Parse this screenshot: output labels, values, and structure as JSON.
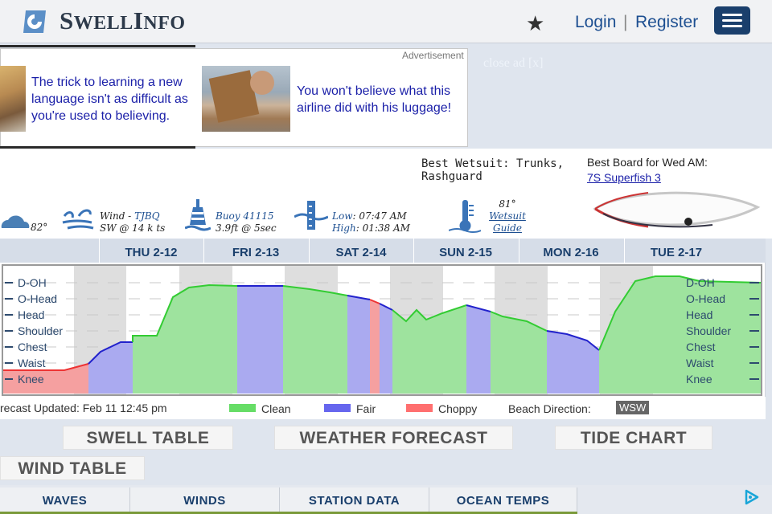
{
  "header": {
    "logo_text_first": "S",
    "logo_text_rest": "WELL",
    "logo_text_first2": "I",
    "logo_text_rest2": "NFO",
    "login": "Login",
    "separator": "|",
    "register": "Register",
    "icons": [
      "logo-icon",
      "star-icon",
      "menu-icon"
    ]
  },
  "ad": {
    "label": "Advertisement",
    "text1": "The trick to learning a new language isn't as difficult as you're used to believing.",
    "text2": "You won't believe what this airline did with his luggage!",
    "close": "close ad [x]"
  },
  "info": {
    "best_wetsuit": "Best Wetsuit: Trunks, Rashguard",
    "best_board_label": "Best Board for Wed AM:",
    "best_board": "7S Superfish 3",
    "air_temp": "82°",
    "wind_label": "Wind - ",
    "wind_station": "TJBQ",
    "wind_value": "SW @ 14 k ts",
    "buoy": "Buoy 41115",
    "buoy_value": "3.9ft @ 5sec",
    "tide_low_label": "Low",
    "tide_low": ": 07:47 AM",
    "tide_high_label": "High",
    "tide_high": ": 01:38 AM",
    "water_temp": "81°",
    "wetsuit_guide_1": "Wetsuit",
    "wetsuit_guide_2": "Guide"
  },
  "forecast": {
    "days": [
      "THU 2-12",
      "FRI 2-13",
      "SAT 2-14",
      "SUN 2-15",
      "MON 2-16",
      "TUE 2-17"
    ],
    "size_labels": [
      "D-OH",
      "O-Head",
      "Head",
      "Shoulder",
      "Chest",
      "Waist",
      "Knee"
    ],
    "updated": "recast Updated: Feb 11 12:45 pm",
    "legend": [
      {
        "label": "Clean",
        "color": "#66dd66"
      },
      {
        "label": "Fair",
        "color": "#6666ee"
      },
      {
        "label": "Choppy",
        "color": "#ff6f6f"
      }
    ],
    "beach_direction_label": "Beach Direction:",
    "beach_direction": "WSW",
    "colors": {
      "clean_fill": "#9ee39e",
      "fair_fill": "#aaaaf0",
      "choppy_fill": "#f5a0a0",
      "clean_line": "#33cc33",
      "fair_line": "#2222cc",
      "choppy_line": "#ee3333"
    }
  },
  "buttons": {
    "swell_table": "SWELL TABLE",
    "weather_forecast": "WEATHER FORECAST",
    "tide_chart": "TIDE CHART",
    "wind_table": "WIND TABLE"
  },
  "bottom_nav": [
    "WAVES",
    "WINDS",
    "STATION DATA",
    "OCEAN TEMPS"
  ]
}
